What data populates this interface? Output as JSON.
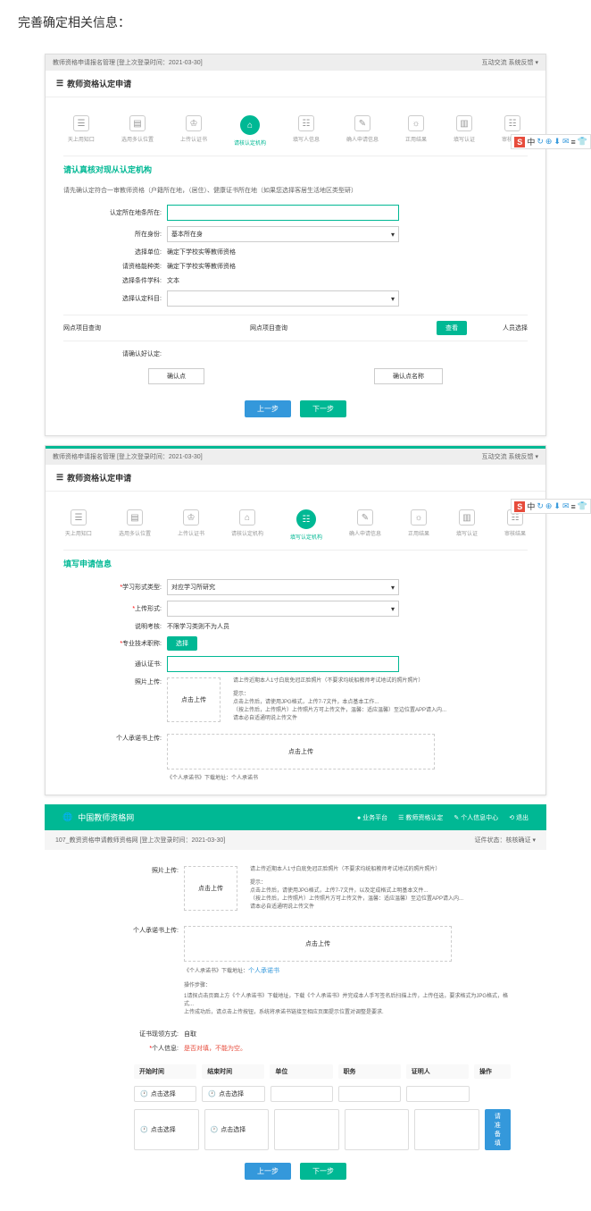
{
  "page_title": "完善确定相关信息：",
  "topbar_date": "2021-03-30",
  "topbar_prefix": "教师资格申请报名管理 [登上次登录时间：",
  "topbar_right": "互动交流 系统反馈 ▾",
  "panel1": {
    "header": "教师资格认定申请",
    "section_title": "请认真核对现从认定机构",
    "note": "请先确认定符合一审教师资格（户籍所在地，（居住）、健康证书所在地（如果您选择客居生活地区类型研）",
    "fields": {
      "f1": "认定所在地条所在:",
      "f2": "所在身份:",
      "f2_val": "基本所在身",
      "f3": "选择单位:",
      "f3_val": "确定下学校实等教师资格",
      "f4": "请资格能种类:",
      "f4_val": "确定下学校实等教师资格",
      "f5": "选择条件学科:",
      "f5_val": "文本",
      "f6": "选择认定科目:"
    },
    "search": {
      "c1": "网点项目查询",
      "c2": "网点项目查询",
      "c3": "人员选择",
      "btn": "查看"
    },
    "confirm_label": "请确认好认定:",
    "confirm1": "确认点",
    "confirm2": "确认点名称"
  },
  "panel2": {
    "header": "教师资格认定申请",
    "section_title": "填写申请信息",
    "fields": {
      "f1": "学习形式类型:",
      "f1_val": "对应学习所研究",
      "f2": "上传形式:",
      "f3": "说明考核:",
      "f3_val": "不限学习类则不为人员",
      "f4": "专业技术职称:",
      "f4_btn": "选择",
      "f5": "通认证书:",
      "f6": "照片上传:",
      "f6_btn": "点击上传",
      "f6_note_top": "请上传近期本人1寸白底免冠正脸照片（不要求均统船教师考试地试的照片照片）",
      "f6_note": "提示：\n点击上传后，请使用JPG格式，上传7-7文件，本点基本工作...\n（按上传后，上传照片）上传照片方可上传文件，温馨：适应温馨）至边位置APP请入内...\n请本必自适通明说上传文件",
      "f7": "个人承诺书上传:",
      "f7_btn": "点击上传",
      "f7_note": "《个人承诺书》下载地址：个人承诺书"
    }
  },
  "panel3": {
    "site_name": "中国教师资格网",
    "nav": [
      "业务平台",
      "教师资格认定",
      "个人信息中心",
      "退出"
    ],
    "sub_left": "107_教资资格申请教师资格网 [登上次登录时间：2021-03-30]",
    "sub_right": "证件状态：核核确证 ▾",
    "fields": {
      "f1": "照片上传:",
      "f1_btn": "点击上传",
      "f1_note_top": "请上传近期本人1寸白底免冠正脸照片（不要求均统船教师考试地试的照片照片）",
      "f1_note": "提示：\n点击上传后，请使用JPG格式，上传7-7文件，以及定成格式上明基本文件...\n（按上传后，上传照片）上传照片方可上传文件，温馨：适应温馨）至边位置APP请入内...\n请本必自适通明说上传文件",
      "f2": "个人承诺书上传:",
      "f2_btn": "点击上传",
      "f2_link_label": "《个人承诺书》下载地址：",
      "f2_link": "个人承诺书",
      "proc_title": "操作步骤：",
      "proc_text": "1请探点击页面上方《个人承诺书》下载地址，下载《个人承诺书》并完成本人手写签名后扫描上传，上传任选，要求格式为JPG格式，格式...\n上传成功后，请点击上传按钮，系统将承诺书链接至相应页面提示位置对调整是要求.",
      "f3": "证书现领方式:",
      "f3_val": "自取",
      "f4": "个人信息:",
      "f4_val": "是否对填，不能为空。"
    },
    "table": {
      "headers": [
        "开始时间",
        "结束时间",
        "单位",
        "职务",
        "证明人",
        "操作"
      ],
      "rows": [
        [
          "点击选择",
          "点击选择",
          "",
          "",
          "",
          ""
        ],
        [
          "点击选择",
          "点击选择",
          "",
          "",
          "",
          ""
        ]
      ],
      "add_btn": "请准备填"
    }
  },
  "buttons": {
    "prev": "上一步",
    "next": "下一步"
  },
  "ime": [
    "中",
    "↻",
    "⊕",
    "⬇",
    "✉",
    "≡",
    "👕"
  ]
}
